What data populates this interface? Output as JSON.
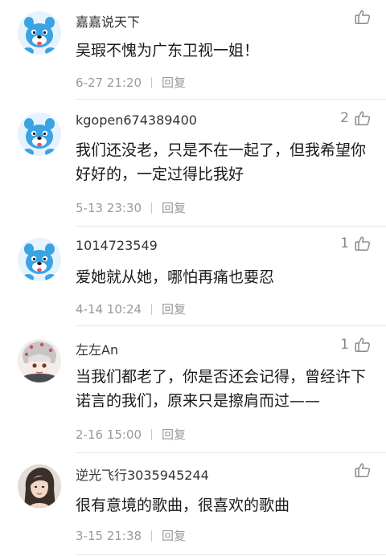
{
  "comments": [
    {
      "username": "嘉嘉说天下",
      "likes": "",
      "text": "吴瑕不愧为广东卫视一姐！",
      "time": "6-27 21:20",
      "reply_label": "回复",
      "avatar": "blue-dog-avatar-icon"
    },
    {
      "username": "kgopen674389400",
      "likes": "2",
      "text": "我们还没老，只是不在一起了，但我希望你好好的，一定过得比我好",
      "time": "5-13 23:30",
      "reply_label": "回复",
      "avatar": "blue-dog-avatar-icon"
    },
    {
      "username": "1014723549",
      "likes": "1",
      "text": "爱她就从她，哪怕再痛也要忍",
      "time": "4-14 10:24",
      "reply_label": "回复",
      "avatar": "blue-dog-avatar-icon"
    },
    {
      "username": "左左An",
      "likes": "1",
      "text": "当我们都老了，你是否还会记得，曾经许下诺言的我们，原来只是擦肩而过——",
      "time": "2-16 15:00",
      "reply_label": "回复",
      "avatar": "anime-character-avatar-icon"
    },
    {
      "username": "逆光飞行3035945244",
      "likes": "",
      "text": "很有意境的歌曲，很喜欢的歌曲",
      "time": "3-15 21:38",
      "reply_label": "回复",
      "avatar": "woman-photo-avatar-icon"
    }
  ],
  "colors": {
    "text": "#1a1a1a",
    "meta": "#9a9a9a",
    "divider": "#e6e6e6",
    "avatar_blue": "#3aa3e3"
  }
}
